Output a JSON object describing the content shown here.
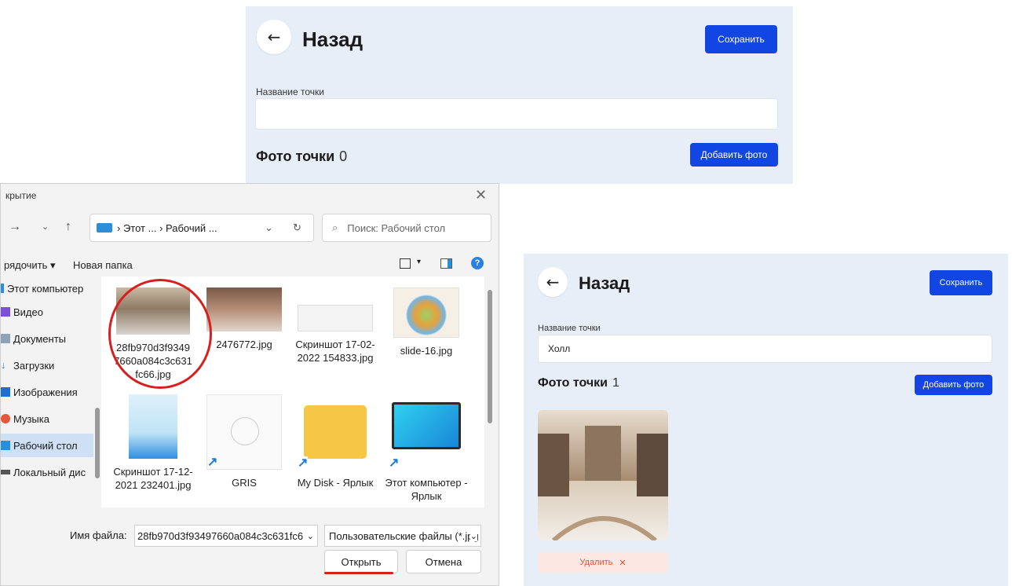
{
  "top_panel": {
    "back_icon": "arrow-left-icon",
    "title": "Назад",
    "save_label": "Сохранить",
    "name_label": "Название точки",
    "name_value": "",
    "photos_label": "Фото точки",
    "photos_count": "0",
    "add_photo_label": "Добавить фото"
  },
  "bottom_panel": {
    "title": "Назад",
    "save_label": "Сохранить",
    "name_label": "Название точки",
    "name_value": "Холл",
    "photos_label": "Фото точки",
    "photos_count": "1",
    "add_photo_label": "Добавить фото",
    "delete_label": "Удалить",
    "delete_icon": "✕"
  },
  "dialog": {
    "title": "крытие",
    "path_seg_1": "Этот ...",
    "path_seg_2": "Рабочий ...",
    "search_placeholder": "Поиск: Рабочий стол",
    "organize_label": "рядочить ▾",
    "new_folder_label": "Новая папка",
    "sidebar": [
      {
        "label": "Этот компьютер",
        "icon": "computer-icon"
      },
      {
        "label": "Видео",
        "icon": "video-icon"
      },
      {
        "label": "Документы",
        "icon": "documents-icon"
      },
      {
        "label": "Загрузки",
        "icon": "download-icon"
      },
      {
        "label": "Изображения",
        "icon": "images-icon"
      },
      {
        "label": "Музыка",
        "icon": "music-icon"
      },
      {
        "label": "Рабочий стол",
        "icon": "desktop-icon"
      },
      {
        "label": "Локальный дис",
        "icon": "drive-icon"
      }
    ],
    "files": [
      {
        "name": "28fb970d3f9349 7660a084c3c631 fc66.jpg"
      },
      {
        "name": "2476772.jpg"
      },
      {
        "name": "Скриншот 17-02-2022 154833.jpg"
      },
      {
        "name": "slide-16.jpg"
      },
      {
        "name": "Скриншот 17-12-2021 232401.jpg"
      },
      {
        "name": "GRIS"
      },
      {
        "name": "My Disk - Ярлык"
      },
      {
        "name": "Этот компьютер - Ярлык"
      }
    ],
    "filename_label": "Имя файла:",
    "filename_value": "28fb970d3f93497660a084c3c631fc6",
    "filetype_value": "Пользовательские файлы (*.jpg",
    "open_label": "Открыть",
    "cancel_label": "Отмена"
  },
  "colors": {
    "panel_bg": "#e8eef8",
    "primary": "#1246e2",
    "annotation_red": "#d81e1e"
  }
}
